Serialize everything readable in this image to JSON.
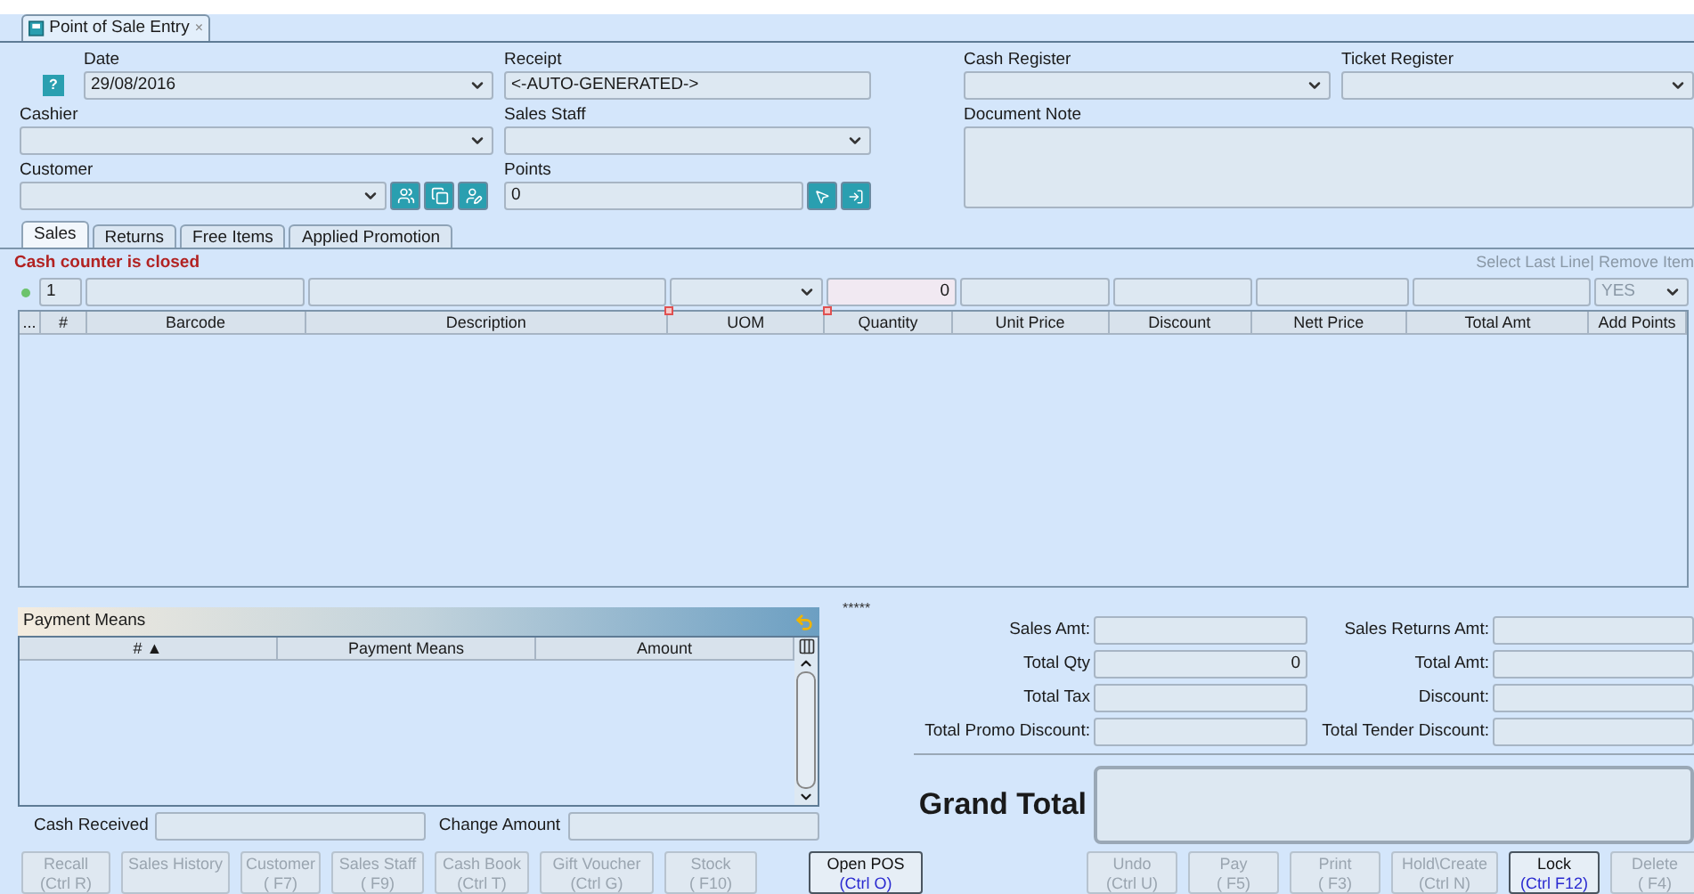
{
  "tab": {
    "title": "Point of Sale Entry",
    "close": "×"
  },
  "header": {
    "help": "?",
    "date": {
      "label": "Date",
      "value": "29/08/2016"
    },
    "receipt": {
      "label": "Receipt",
      "value": "<-AUTO-GENERATED->"
    },
    "cash_register": {
      "label": "Cash Register"
    },
    "ticket_register": {
      "label": "Ticket Register"
    },
    "cashier": {
      "label": "Cashier"
    },
    "sales_staff": {
      "label": "Sales Staff"
    },
    "document_note": {
      "label": "Document Note"
    },
    "customer": {
      "label": "Customer"
    },
    "points": {
      "label": "Points",
      "value": "0"
    }
  },
  "tabs": [
    {
      "label": "Sales",
      "selected": true
    },
    {
      "label": "Returns",
      "selected": false
    },
    {
      "label": "Free Items",
      "selected": false
    },
    {
      "label": "Applied Promotion",
      "selected": false
    }
  ],
  "status_message": "Cash counter is closed",
  "line_actions": "Select Last Line| Remove Item",
  "entry_row": {
    "line_no": "1",
    "quantity": "0",
    "add_points": "YES"
  },
  "columns": [
    "...",
    "#",
    "Barcode",
    "Description",
    "UOM",
    "Quantity",
    "Unit Price",
    "Discount",
    "Nett Price",
    "Total Amt",
    "Add Points"
  ],
  "payment_means": {
    "title": "Payment Means",
    "columns": [
      "# ▲",
      "Payment Means",
      "Amount"
    ],
    "cash_received": {
      "label": "Cash Received"
    },
    "change_amount": {
      "label": "Change Amount"
    }
  },
  "summary_marker": "*****",
  "totals_left": [
    {
      "label": "Sales Amt:"
    },
    {
      "label": "Total Qty",
      "value": "0"
    },
    {
      "label": "Total Tax"
    },
    {
      "label": "Total Promo Discount:"
    }
  ],
  "totals_right": [
    {
      "label": "Sales Returns Amt:"
    },
    {
      "label": "Total Amt:"
    },
    {
      "label": "Discount:"
    },
    {
      "label": "Total Tender Discount:"
    }
  ],
  "grand_total": {
    "label": "Grand Total"
  },
  "buttons_left": [
    {
      "label": "Recall",
      "shortcut": "(Ctrl R)",
      "disabled": true
    },
    {
      "label": "Sales History",
      "disabled": true
    },
    {
      "label": "Customer",
      "shortcut": "( F7)",
      "disabled": true
    },
    {
      "label": "Sales Staff",
      "shortcut": "( F9)",
      "disabled": true
    },
    {
      "label": "Cash Book",
      "shortcut": "(Ctrl T)",
      "disabled": true
    },
    {
      "label": "Gift Voucher",
      "shortcut": "(Ctrl G)",
      "disabled": true
    },
    {
      "label": "Stock",
      "shortcut": "( F10)",
      "disabled": true
    }
  ],
  "buttons_middle": [
    {
      "label": "Open POS",
      "shortcut": "(Ctrl O)",
      "disabled": false
    }
  ],
  "buttons_right": [
    {
      "label": "Undo",
      "shortcut": "(Ctrl U)",
      "disabled": true
    },
    {
      "label": "Pay",
      "shortcut": "( F5)",
      "disabled": true
    },
    {
      "label": "Print",
      "shortcut": "( F3)",
      "disabled": true
    },
    {
      "label": "Hold\\Create",
      "shortcut": "(Ctrl N)",
      "disabled": true
    },
    {
      "label": "Lock",
      "shortcut": "(Ctrl F12)",
      "disabled": false
    },
    {
      "label": "Delete",
      "shortcut": "( F4)",
      "disabled": true
    }
  ]
}
